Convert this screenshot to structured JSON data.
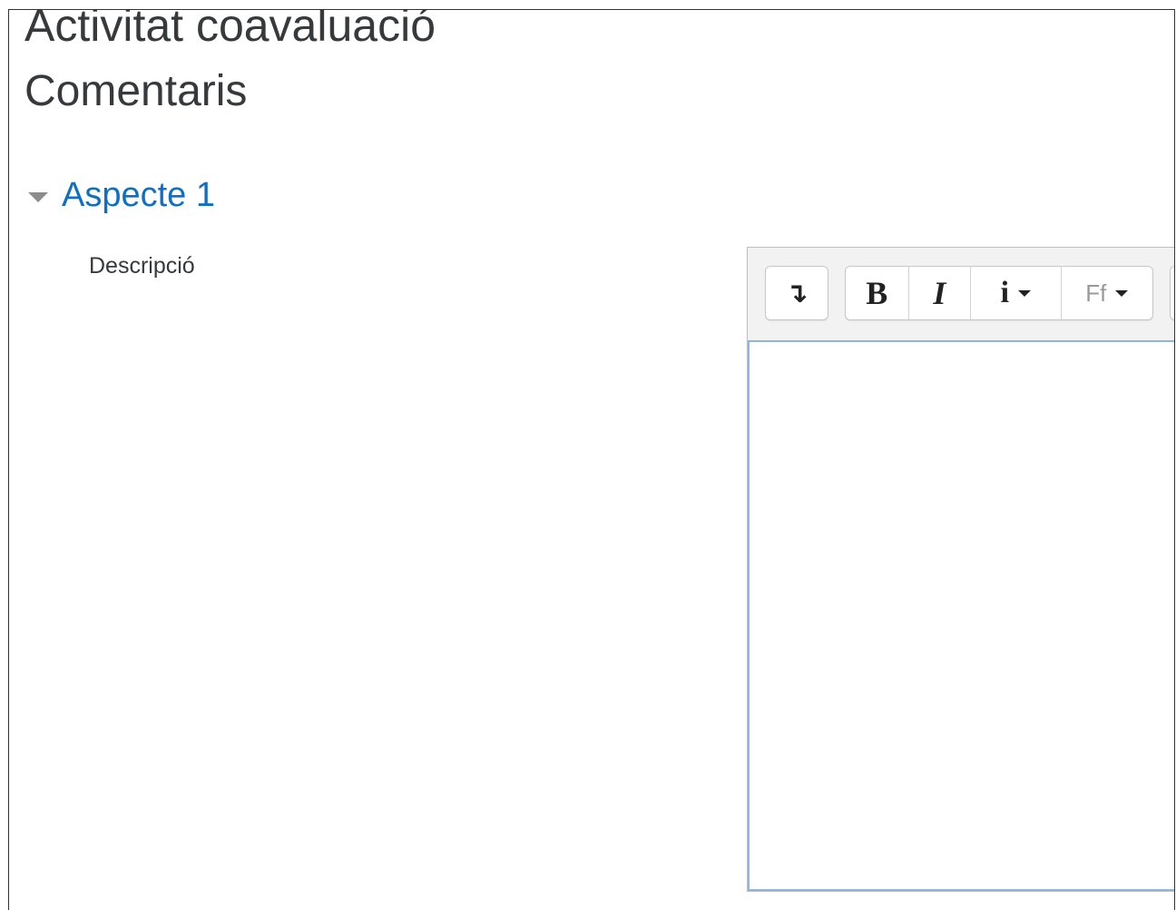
{
  "page": {
    "title": "Activitat coavaluació",
    "section_title": "Comentaris"
  },
  "aspect": {
    "label": "Aspecte 1",
    "expanded": true,
    "field_label": "Descripció"
  },
  "editor": {
    "toolbar": {
      "collapse_icon_glyph": "↴",
      "bold_glyph": "B",
      "italic_glyph": "I",
      "info_glyph": "i",
      "font_glyph": "Ff"
    },
    "content": ""
  },
  "colors": {
    "heading": "#373a3c",
    "link": "#0f6fc5",
    "toolbar_bg": "#f2f2f2",
    "editor_focus_border": "#8fb6e0"
  }
}
